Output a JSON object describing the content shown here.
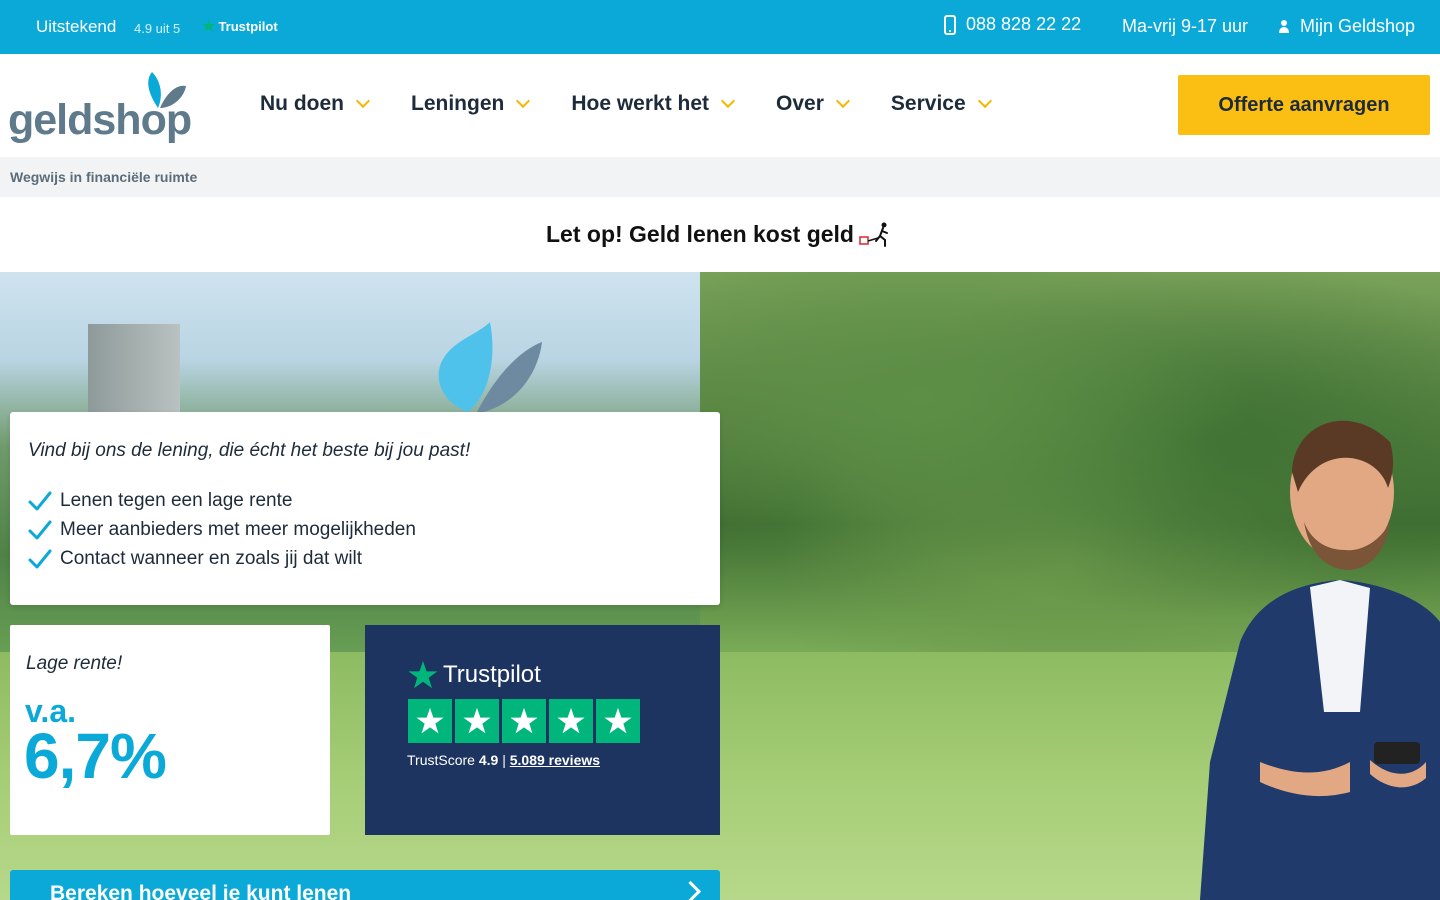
{
  "topbar": {
    "rating_label": "Uitstekend",
    "rating_score": "4.9 uit 5",
    "trustpilot_label": "Trustpilot",
    "phone": "088 828 22 22",
    "hours": "Ma-vrij 9-17 uur",
    "account": "Mijn Geldshop"
  },
  "header": {
    "logo_text": "geldshop",
    "nav": [
      {
        "label": "Nu doen"
      },
      {
        "label": "Leningen"
      },
      {
        "label": "Hoe werkt het"
      },
      {
        "label": "Over"
      },
      {
        "label": "Service"
      }
    ],
    "cta_label": "Offerte aanvragen"
  },
  "tagline": "Wegwijs in financiële ruimte",
  "warning": "Let op! Geld lenen kost geld",
  "intro": {
    "lead": "Vind bij ons de lening, die écht het beste bij jou past!",
    "bullets": [
      "Lenen tegen een lage rente",
      "Meer aanbieders met meer mogelijkheden",
      "Contact wanneer en zoals jij dat wilt"
    ]
  },
  "rate": {
    "label": "Lage rente!",
    "prefix": "v.a.",
    "value": "6,7%"
  },
  "trustpilot": {
    "brand": "Trustpilot",
    "score_label": "TrustScore",
    "score": "4.9",
    "separator": "|",
    "reviews": "5.089 reviews",
    "stars": 5
  },
  "calculator_button": "Bereken hoeveel je kunt lenen",
  "colors": {
    "brand_blue": "#0aa9d8",
    "cta_yellow": "#fbbe12",
    "trustpilot_navy": "#1d3461",
    "trustpilot_green": "#00b67a"
  }
}
